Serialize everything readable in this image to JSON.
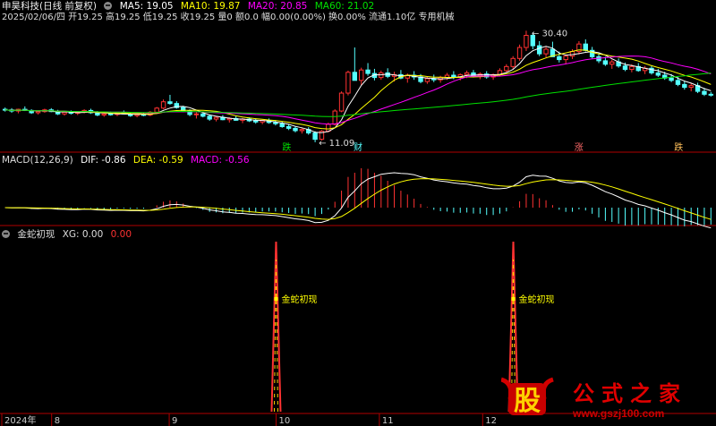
{
  "header": {
    "title": "申昊科技(日线 前复权)",
    "ma5": "MA5: 19.05",
    "ma10": "MA10: 19.87",
    "ma20": "MA20: 20.85",
    "ma60": "MA60: 21.02",
    "info": "2025/02/06/四 开19.25 高19.25 低19.25 收19.25 量0 额0.0 幅0.00(0.00%) 换0.00% 流通1.10亿 专用机械"
  },
  "macd_header": {
    "name": "MACD(12,26,9)",
    "dif": "DIF: -0.86",
    "dea": "DEA: -0.59",
    "macd": "MACD: -0.56"
  },
  "signal_header": {
    "name": "金蛇初现",
    "xg": "XG: 0.00",
    "v": "0.00"
  },
  "watermark": {
    "brand": "公式之家",
    "logo": "股",
    "url": "www.gszj100.com"
  },
  "colors": {
    "up": "#ff3232",
    "down": "#54ffff",
    "ma5": "#ffffff",
    "ma10": "#ffff00",
    "ma20": "#ff00ff",
    "ma60": "#00e000",
    "dif": "#ffffff",
    "dea": "#ffff00",
    "macd_label": "#ff00ff",
    "signal": "#ff3232",
    "signal_label": "#ffff00",
    "axis": "#b00000"
  },
  "chart_data": {
    "type": "candlestick",
    "price_labels": {
      "high": "30.40",
      "low": "11.09"
    },
    "price_range": [
      10,
      32
    ],
    "time_axis": [
      "2024年",
      "8",
      "9",
      "10",
      "11",
      "12"
    ],
    "event_tags": [
      "跌",
      "财",
      "涨",
      "跌"
    ],
    "candles": [
      [
        16.8,
        17.1,
        16.4,
        16.7
      ],
      [
        16.7,
        17.0,
        16.2,
        16.5
      ],
      [
        16.5,
        16.9,
        16.1,
        16.8
      ],
      [
        16.8,
        17.3,
        16.5,
        16.6
      ],
      [
        16.6,
        16.8,
        16.0,
        16.2
      ],
      [
        16.2,
        16.6,
        15.9,
        16.4
      ],
      [
        16.4,
        16.9,
        16.2,
        16.7
      ],
      [
        16.7,
        17.0,
        16.3,
        16.4
      ],
      [
        16.4,
        16.7,
        15.8,
        16.0
      ],
      [
        16.0,
        16.4,
        15.7,
        16.3
      ],
      [
        16.3,
        16.6,
        15.9,
        16.1
      ],
      [
        16.1,
        16.5,
        15.8,
        16.3
      ],
      [
        16.3,
        16.8,
        16.1,
        16.6
      ],
      [
        16.6,
        16.9,
        16.0,
        16.2
      ],
      [
        16.2,
        16.5,
        15.6,
        15.8
      ],
      [
        15.8,
        16.2,
        15.5,
        16.0
      ],
      [
        16.0,
        16.4,
        15.7,
        15.9
      ],
      [
        15.9,
        16.3,
        15.6,
        16.2
      ],
      [
        16.2,
        16.6,
        15.9,
        16.0
      ],
      [
        16.0,
        16.3,
        15.5,
        15.7
      ],
      [
        15.7,
        16.1,
        15.4,
        15.9
      ],
      [
        15.9,
        16.2,
        15.6,
        15.8
      ],
      [
        15.8,
        16.5,
        15.6,
        16.3
      ],
      [
        16.3,
        17.2,
        16.1,
        17.0
      ],
      [
        17.0,
        18.5,
        16.8,
        18.1
      ],
      [
        18.1,
        19.3,
        17.6,
        17.8
      ],
      [
        17.8,
        18.2,
        16.9,
        17.1
      ],
      [
        17.1,
        17.4,
        16.3,
        16.5
      ],
      [
        16.5,
        16.8,
        15.6,
        15.9
      ],
      [
        15.9,
        16.3,
        15.2,
        16.0
      ],
      [
        16.0,
        16.4,
        15.4,
        15.6
      ],
      [
        15.6,
        15.9,
        14.8,
        15.1
      ],
      [
        15.1,
        15.6,
        14.7,
        15.4
      ],
      [
        15.4,
        15.8,
        14.9,
        15.0
      ],
      [
        15.0,
        15.4,
        14.5,
        15.2
      ],
      [
        15.2,
        15.6,
        14.8,
        14.9
      ],
      [
        14.9,
        15.3,
        14.4,
        15.1
      ],
      [
        15.1,
        15.4,
        14.6,
        14.8
      ],
      [
        14.8,
        15.2,
        14.3,
        14.6
      ],
      [
        14.6,
        15.0,
        14.2,
        14.9
      ],
      [
        14.9,
        15.2,
        14.3,
        14.5
      ],
      [
        14.5,
        14.9,
        14.0,
        14.3
      ],
      [
        14.3,
        14.7,
        13.6,
        13.8
      ],
      [
        13.8,
        14.2,
        13.2,
        13.5
      ],
      [
        13.5,
        13.9,
        12.8,
        13.1
      ],
      [
        13.1,
        13.6,
        12.6,
        13.3
      ],
      [
        13.3,
        13.7,
        12.4,
        12.7
      ],
      [
        12.7,
        13.0,
        11.09,
        11.6
      ],
      [
        11.6,
        13.2,
        11.4,
        13.0
      ],
      [
        13.0,
        14.5,
        12.8,
        14.2
      ],
      [
        14.2,
        16.8,
        14.0,
        16.5
      ],
      [
        16.5,
        19.9,
        16.3,
        19.6
      ],
      [
        19.6,
        23.5,
        19.2,
        23.2
      ],
      [
        23.2,
        27.5,
        22.5,
        21.8
      ],
      [
        21.8,
        24.0,
        21.0,
        23.6
      ],
      [
        23.6,
        24.8,
        22.6,
        23.0
      ],
      [
        23.0,
        23.8,
        21.8,
        22.3
      ],
      [
        22.3,
        23.5,
        21.9,
        23.1
      ],
      [
        23.1,
        23.9,
        22.2,
        22.5
      ],
      [
        22.5,
        23.3,
        21.6,
        22.8
      ],
      [
        22.8,
        23.6,
        22.0,
        22.2
      ],
      [
        22.2,
        23.0,
        21.4,
        22.7
      ],
      [
        22.7,
        23.4,
        21.9,
        22.4
      ],
      [
        22.4,
        22.9,
        21.3,
        21.6
      ],
      [
        21.6,
        22.5,
        21.2,
        22.1
      ],
      [
        22.1,
        22.8,
        21.5,
        21.9
      ],
      [
        21.9,
        22.6,
        21.4,
        22.3
      ],
      [
        22.3,
        23.1,
        21.9,
        22.7
      ],
      [
        22.7,
        23.4,
        22.0,
        22.4
      ],
      [
        22.4,
        23.0,
        21.8,
        22.8
      ],
      [
        22.8,
        23.5,
        22.2,
        23.1
      ],
      [
        23.1,
        23.6,
        22.3,
        22.6
      ],
      [
        22.6,
        23.2,
        22.0,
        22.9
      ],
      [
        22.9,
        23.4,
        22.1,
        22.4
      ],
      [
        22.4,
        23.0,
        21.9,
        22.8
      ],
      [
        22.8,
        23.9,
        22.5,
        23.5
      ],
      [
        23.5,
        24.6,
        23.1,
        24.2
      ],
      [
        24.2,
        26.0,
        23.8,
        25.6
      ],
      [
        25.6,
        28.0,
        25.2,
        27.5
      ],
      [
        27.5,
        30.4,
        26.9,
        29.6
      ],
      [
        29.6,
        30.1,
        27.2,
        27.8
      ],
      [
        27.8,
        28.6,
        26.0,
        26.4
      ],
      [
        26.4,
        27.6,
        25.8,
        27.2
      ],
      [
        27.2,
        28.5,
        26.6,
        25.9
      ],
      [
        25.9,
        26.8,
        24.9,
        25.4
      ],
      [
        25.4,
        26.3,
        24.6,
        26.0
      ],
      [
        26.0,
        27.2,
        25.5,
        26.8
      ],
      [
        26.8,
        28.6,
        26.3,
        28.1
      ],
      [
        28.1,
        28.9,
        26.8,
        27.0
      ],
      [
        27.0,
        27.6,
        25.6,
        25.9
      ],
      [
        25.9,
        26.5,
        24.8,
        25.2
      ],
      [
        25.2,
        25.9,
        24.3,
        24.6
      ],
      [
        24.6,
        25.4,
        23.8,
        25.0
      ],
      [
        25.0,
        25.6,
        24.0,
        24.3
      ],
      [
        24.3,
        24.9,
        23.4,
        23.7
      ],
      [
        23.7,
        24.6,
        23.2,
        24.2
      ],
      [
        24.2,
        24.8,
        23.3,
        23.5
      ],
      [
        23.5,
        24.3,
        22.9,
        23.9
      ],
      [
        23.9,
        24.4,
        22.8,
        23.1
      ],
      [
        23.1,
        23.8,
        22.4,
        22.7
      ],
      [
        22.7,
        23.3,
        21.9,
        22.2
      ],
      [
        22.2,
        22.9,
        21.5,
        21.8
      ],
      [
        21.8,
        22.4,
        20.8,
        21.1
      ],
      [
        21.1,
        21.7,
        20.2,
        20.6
      ],
      [
        20.6,
        21.3,
        19.9,
        20.9
      ],
      [
        20.9,
        21.4,
        19.6,
        19.9
      ],
      [
        19.9,
        20.5,
        19.1,
        19.4
      ],
      [
        19.4,
        19.8,
        19.0,
        19.25
      ]
    ],
    "signal_spikes": [
      {
        "label": "金蛇初现",
        "position": 0.385
      },
      {
        "label": "金蛇初现",
        "position": 0.718
      }
    ]
  }
}
